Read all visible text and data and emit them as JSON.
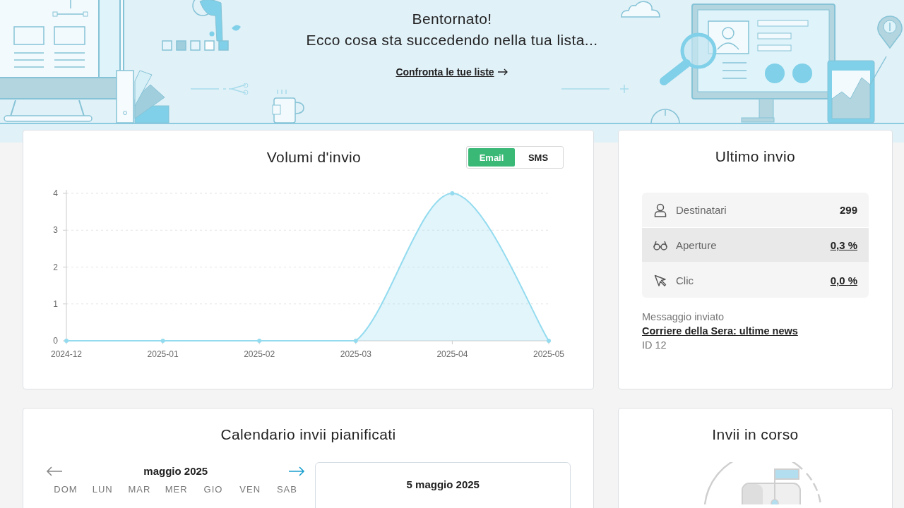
{
  "banner": {
    "title": "Bentornato!",
    "subtitle": "Ecco cosa sta succedendo nella tua lista...",
    "link": "Confronta le tue liste"
  },
  "volumes": {
    "title": "Volumi d'invio",
    "toggle": [
      {
        "label": "Email",
        "selected": true
      },
      {
        "label": "SMS",
        "selected": false
      }
    ],
    "chart_data": {
      "type": "area",
      "categories": [
        "2024-12",
        "2025-01",
        "2025-02",
        "2025-03",
        "2025-04",
        "2025-05"
      ],
      "series": [
        {
          "color": "#94dbef",
          "values": [
            0,
            0,
            0,
            0,
            4,
            0
          ]
        }
      ],
      "ylim": [
        0,
        4
      ],
      "yticks": [
        0,
        1,
        2,
        3,
        4
      ],
      "grid": true
    }
  },
  "last_send": {
    "title": "Ultimo invio",
    "stats": [
      {
        "kind": "recipients",
        "label": "Destinatari",
        "value": "299",
        "link": false,
        "selected": false
      },
      {
        "kind": "opens",
        "label": "Aperture",
        "value": "0,3 %",
        "link": true,
        "selected": true
      },
      {
        "kind": "clicks",
        "label": "Clic",
        "value": "0,0 %",
        "link": true,
        "selected": false
      }
    ],
    "message_label": "Messaggio inviato",
    "message_title": "Corriere della Sera: ultime news",
    "message_id": "ID 12"
  },
  "calendar": {
    "title": "Calendario invii pianificati",
    "month": "maggio 2025",
    "weekdays": [
      "DOM",
      "LUN",
      "MAR",
      "MER",
      "GIO",
      "VEN",
      "SAB"
    ],
    "selected_date": "5 maggio 2025"
  },
  "in_progress": {
    "title": "Invii in corso"
  }
}
